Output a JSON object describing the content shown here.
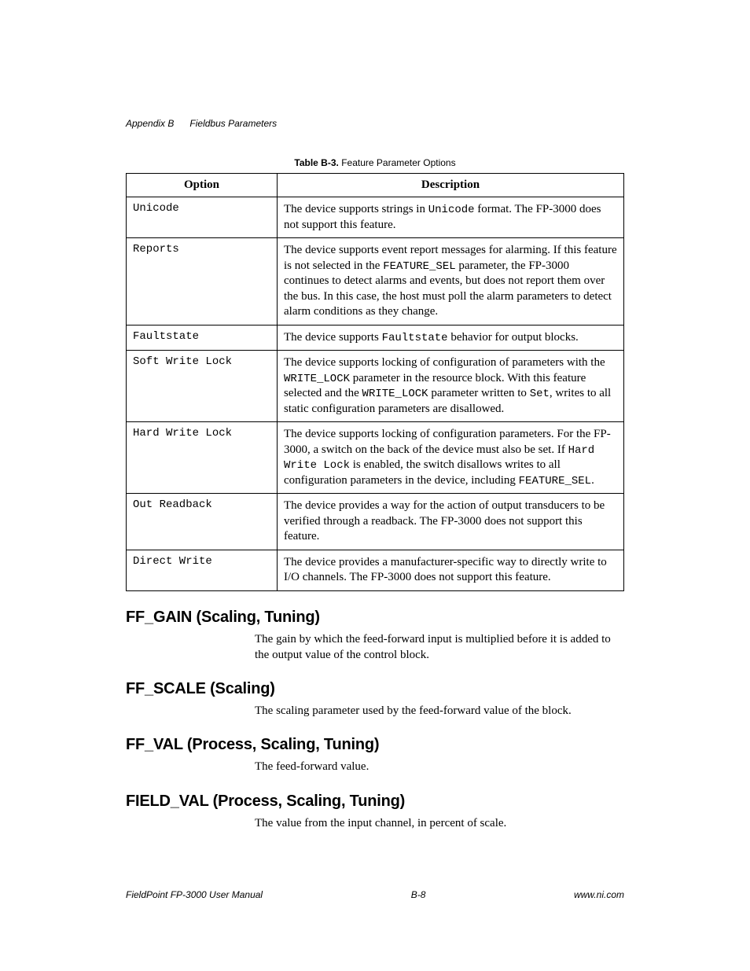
{
  "header": {
    "appendix": "Appendix B",
    "title": "Fieldbus Parameters"
  },
  "table": {
    "caption_bold": "Table B-3.",
    "caption_rest": "Feature Parameter Options",
    "col1": "Option",
    "col2": "Description",
    "rows": [
      {
        "option": "Unicode",
        "desc_pre": "The device supports strings in ",
        "desc_mono1": "Unicode",
        "desc_mid1": " format. The FP-3000 does not support this feature.",
        "desc_mono2": "",
        "desc_mid2": "",
        "desc_mono3": "",
        "desc_mid3": "",
        "desc_mono4": "",
        "desc_post": ""
      },
      {
        "option": "Reports",
        "desc_pre": "The device supports event report messages for alarming. If this feature is not selected in the ",
        "desc_mono1": "FEATURE_SEL",
        "desc_mid1": " parameter, the FP-3000 continues to detect alarms and events, but does not report them over the bus. In this case, the host must poll the alarm parameters to detect alarm conditions as they change.",
        "desc_mono2": "",
        "desc_mid2": "",
        "desc_mono3": "",
        "desc_mid3": "",
        "desc_mono4": "",
        "desc_post": ""
      },
      {
        "option": "Faultstate",
        "desc_pre": "The device supports ",
        "desc_mono1": "Faultstate",
        "desc_mid1": " behavior for output blocks.",
        "desc_mono2": "",
        "desc_mid2": "",
        "desc_mono3": "",
        "desc_mid3": "",
        "desc_mono4": "",
        "desc_post": ""
      },
      {
        "option": "Soft Write Lock",
        "desc_pre": "The device supports locking of configuration of parameters with the ",
        "desc_mono1": "WRITE_LOCK",
        "desc_mid1": " parameter in the resource block. With this feature selected and the ",
        "desc_mono2": "WRITE_LOCK",
        "desc_mid2": " parameter written to ",
        "desc_mono3": "Set",
        "desc_mid3": ", writes to all static configuration parameters are disallowed.",
        "desc_mono4": "",
        "desc_post": ""
      },
      {
        "option": "Hard Write Lock",
        "desc_pre": "The device supports locking of configuration parameters. For the FP-3000, a switch on the back of the device must also be set. If ",
        "desc_mono1": "Hard Write Lock",
        "desc_mid1": " is enabled, the switch disallows writes to all configuration parameters in the device, including ",
        "desc_mono2": "FEATURE_SEL",
        "desc_mid2": ".",
        "desc_mono3": "",
        "desc_mid3": "",
        "desc_mono4": "",
        "desc_post": ""
      },
      {
        "option": "Out Readback",
        "desc_pre": "The device provides a way for the action of output transducers to be verified through a readback. The FP-3000 does not support this feature.",
        "desc_mono1": "",
        "desc_mid1": "",
        "desc_mono2": "",
        "desc_mid2": "",
        "desc_mono3": "",
        "desc_mid3": "",
        "desc_mono4": "",
        "desc_post": ""
      },
      {
        "option": "Direct Write",
        "desc_pre": "The device provides a manufacturer-specific way to directly write to I/O channels. The FP-3000 does not support this feature.",
        "desc_mono1": "",
        "desc_mid1": "",
        "desc_mono2": "",
        "desc_mid2": "",
        "desc_mono3": "",
        "desc_mid3": "",
        "desc_mono4": "",
        "desc_post": ""
      }
    ]
  },
  "sections": [
    {
      "heading": "FF_GAIN (Scaling, Tuning)",
      "body": "The gain by which the feed-forward input is multiplied before it is added to the output value of the control block."
    },
    {
      "heading": "FF_SCALE (Scaling)",
      "body": "The scaling parameter used by the feed-forward value of the block."
    },
    {
      "heading": "FF_VAL (Process, Scaling, Tuning)",
      "body": "The feed-forward value."
    },
    {
      "heading": "FIELD_VAL (Process, Scaling, Tuning)",
      "body": "The value from the input channel, in percent of scale."
    }
  ],
  "footer": {
    "left": "FieldPoint FP-3000 User Manual",
    "center": "B-8",
    "right": "www.ni.com"
  }
}
